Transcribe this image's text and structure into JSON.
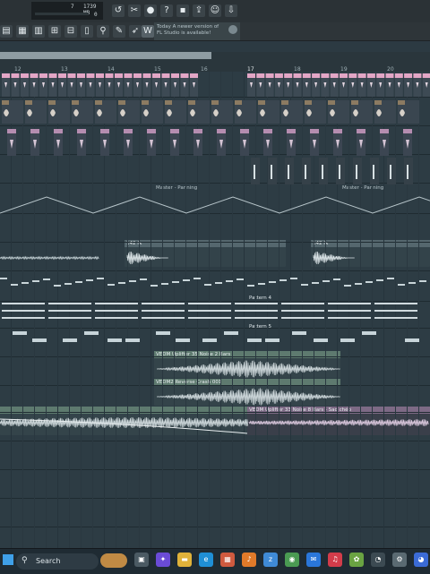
{
  "toolbar": {
    "cpu_value": "7",
    "memory": "1739 MB",
    "voice_count": "0"
  },
  "hint": {
    "line1": "Today  A newer version of",
    "line2": "FL Studio is available!"
  },
  "ruler": {
    "bars": [
      "12",
      "13",
      "14",
      "15",
      "16",
      "17",
      "18",
      "19",
      "20"
    ]
  },
  "clips": {
    "automation": "Master - Panning",
    "fx1": "142 fx",
    "fx2": "142 fx",
    "pattern4": "Pattern 4",
    "pattern5": "Pattern 5",
    "uplifter": "VEDM Uplifter 35 Noise 2 Bars",
    "crash": "VEDM2 Reverse Crash 001",
    "uplifter_copy": "VEDM Uplifter 33 Noise 8 Bars - Sao chép"
  },
  "taskbar": {
    "search_label": "Search"
  },
  "colors": {
    "background": "#2c3a42",
    "clip_pink": "#e3a6c6",
    "clip_purple": "#b58db0",
    "clip_gray": "#9aa7ac",
    "audio_green": "#5a7f73"
  }
}
